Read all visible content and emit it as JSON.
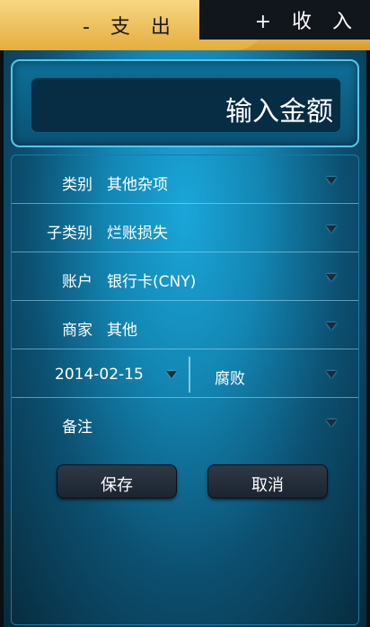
{
  "tabs": {
    "expense": "- 支 出",
    "income": "+ 收 入"
  },
  "amount": {
    "placeholder": "输入金额"
  },
  "form": {
    "category": {
      "label": "类别",
      "value": "其他杂项"
    },
    "subcategory": {
      "label": "子类别",
      "value": "烂账损失"
    },
    "account": {
      "label": "账户",
      "value": "银行卡(CNY)"
    },
    "merchant": {
      "label": "商家",
      "value": "其他"
    },
    "date": {
      "value": "2014-02-15"
    },
    "project": {
      "value": "腐败"
    },
    "note": {
      "label": "备注",
      "value": ""
    }
  },
  "buttons": {
    "save": "保存",
    "cancel": "取消"
  },
  "colors": {
    "tab_accent": "#e5ad3e",
    "panel_blue": "#1386b3",
    "arrow_dark": "#1d2a3a"
  }
}
